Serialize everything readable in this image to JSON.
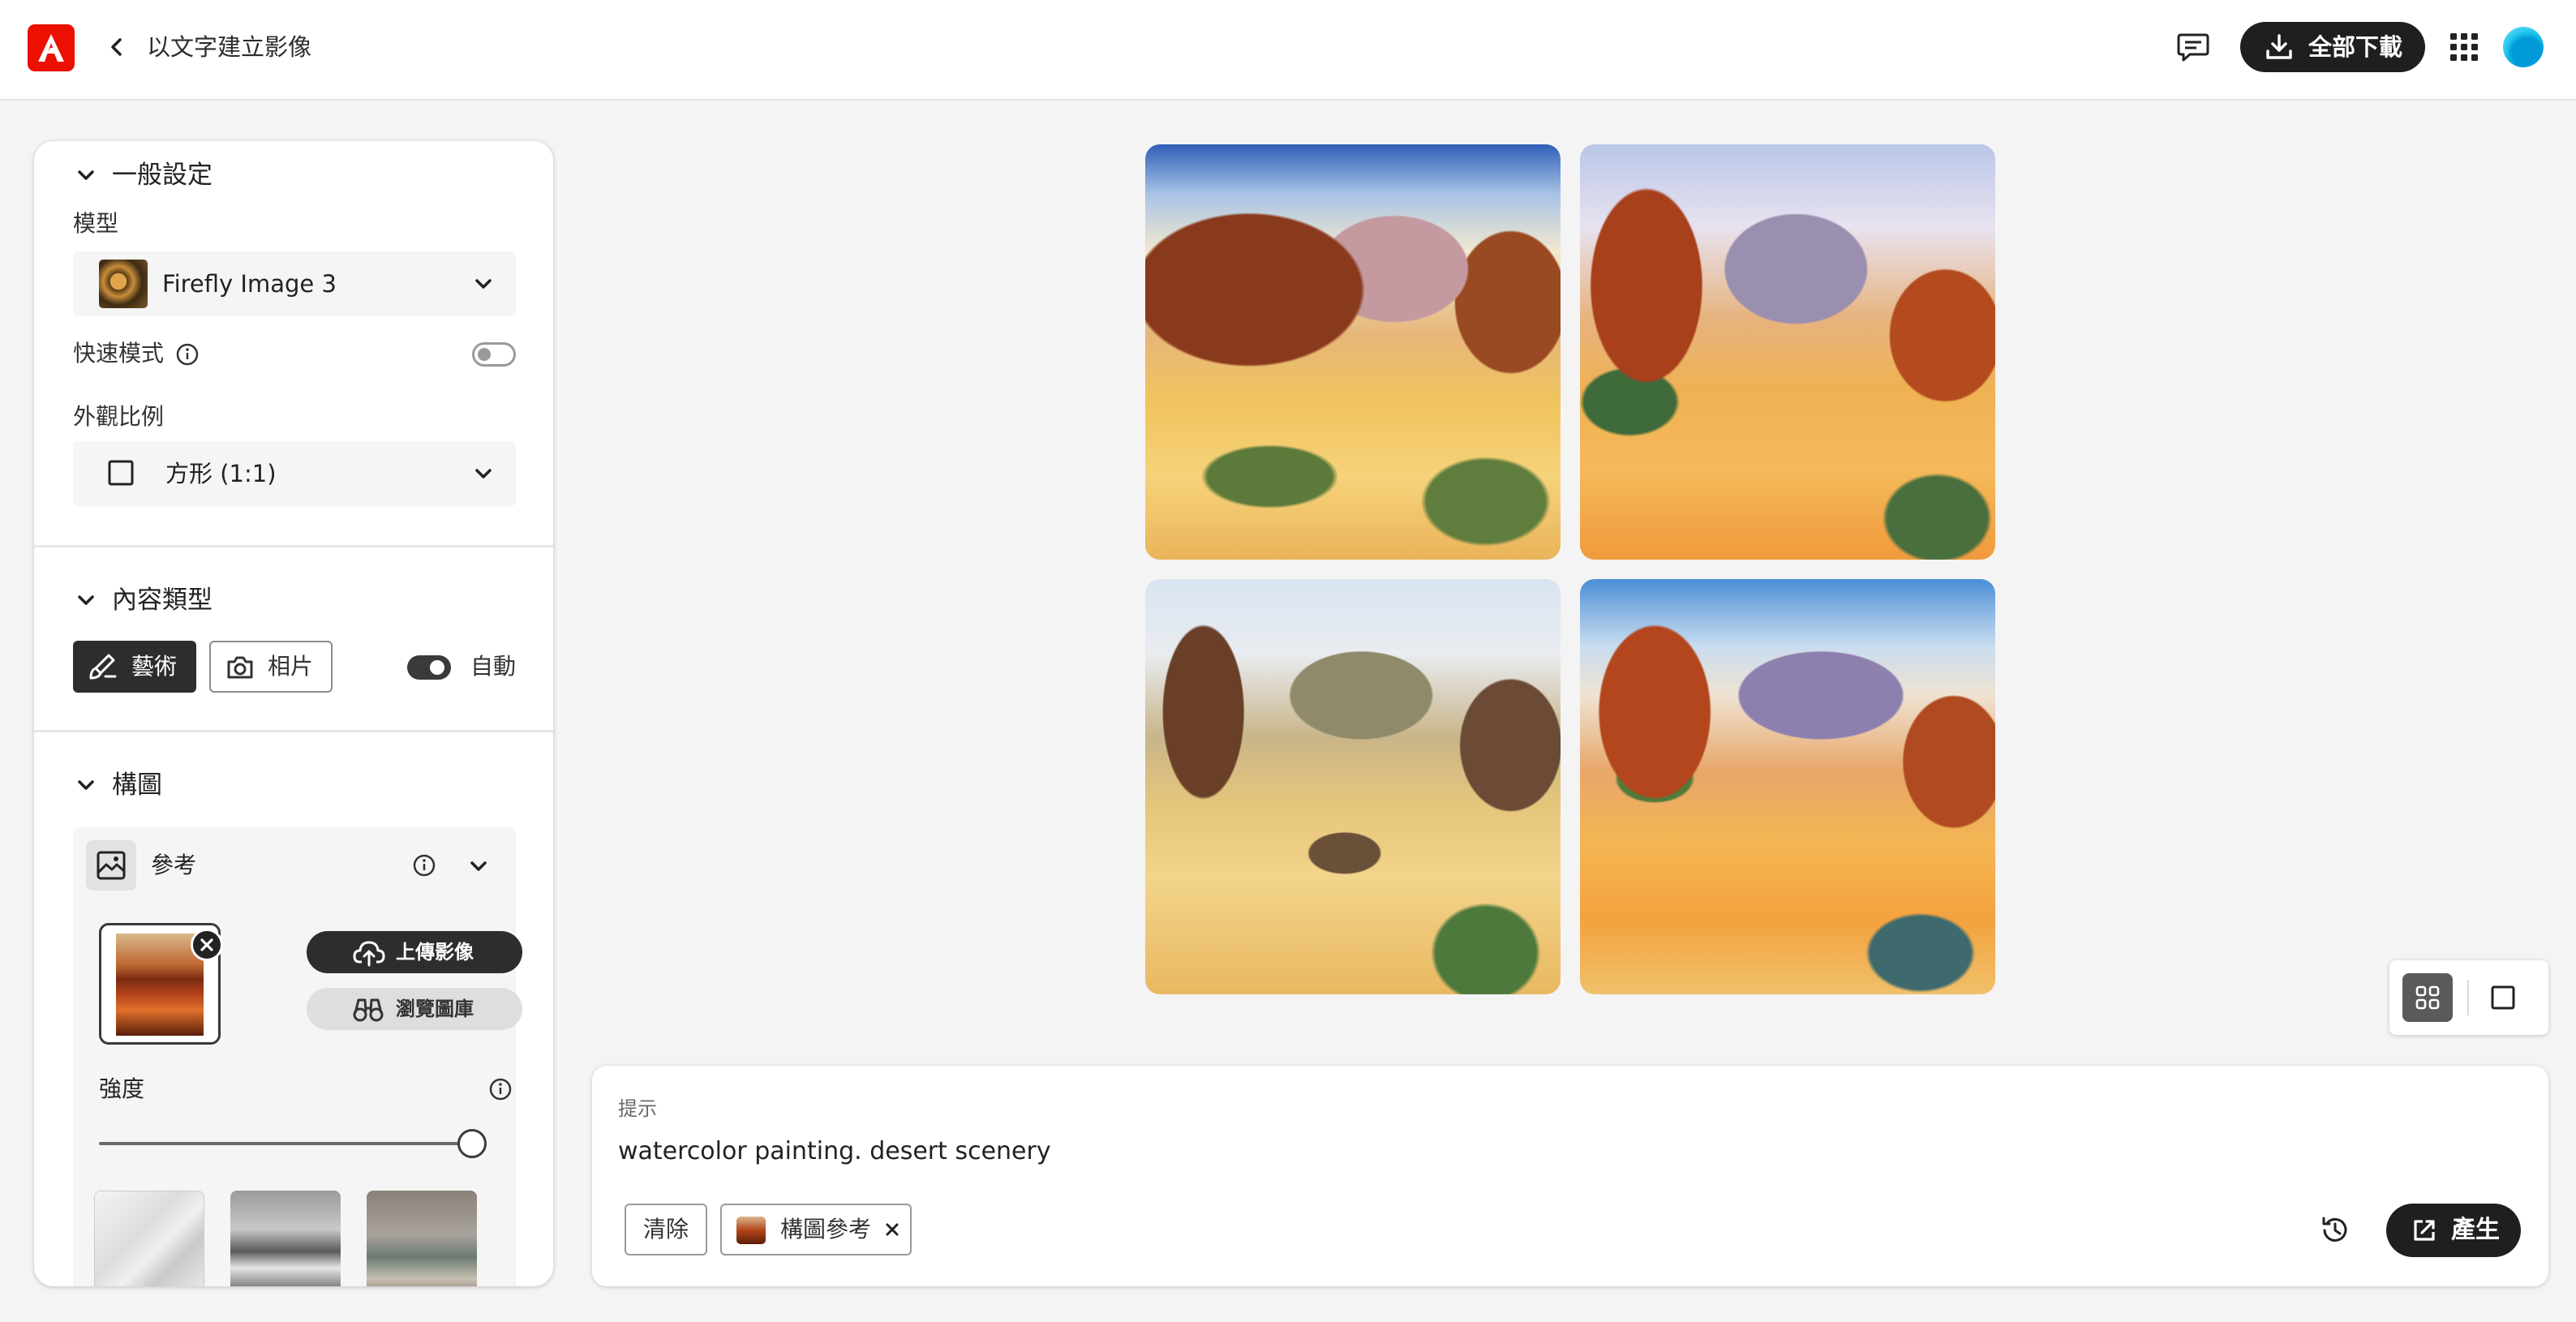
{
  "header": {
    "title": "以文字建立影像",
    "download_all_label": "全部下載"
  },
  "sidebar": {
    "general": {
      "heading": "一般設定",
      "model_label": "模型",
      "model_value": "Firefly Image 3",
      "fast_mode_label": "快速模式",
      "fast_mode_on": false,
      "aspect_label": "外觀比例",
      "aspect_value": "方形 (1:1)"
    },
    "content_type": {
      "heading": "內容類型",
      "art_label": "藝術",
      "photo_label": "相片",
      "auto_label": "自動",
      "auto_on": true,
      "selected": "藝術"
    },
    "composition": {
      "heading": "構圖",
      "reference_label": "參考",
      "upload_label": "上傳影像",
      "browse_label": "瀏覽圖庫",
      "strength_label": "強度",
      "strength_level": 1.0
    }
  },
  "view_toggle": {
    "selected": "grid"
  },
  "prompt": {
    "label": "提示",
    "text": "watercolor painting. desert scenery",
    "clear_label": "清除",
    "chip_label": "構圖參考",
    "generate_label": "產生"
  },
  "colors": {
    "adobe_red": "#eb1000",
    "dark_button": "#1f1f1f",
    "accent_avatar": "#22c8ee"
  },
  "icons": [
    "adobe-logo",
    "chevron-left-icon",
    "chat-icon",
    "download-icon",
    "apps-grid-icon",
    "chevron-down-icon",
    "info-icon",
    "brush-icon",
    "camera-icon",
    "reference-image-icon",
    "close-icon",
    "cloud-upload-icon",
    "binoculars-icon",
    "grid-view-icon",
    "single-view-icon",
    "history-icon",
    "generate-icon"
  ]
}
